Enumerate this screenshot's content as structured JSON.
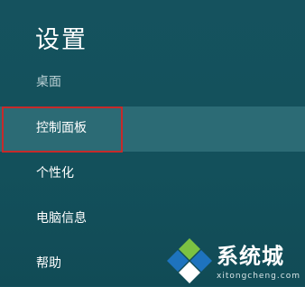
{
  "panel": {
    "title": "设置",
    "context": "桌面"
  },
  "menu": {
    "items": [
      {
        "label": "控制面板",
        "selected": true
      },
      {
        "label": "个性化",
        "selected": false
      },
      {
        "label": "电脑信息",
        "selected": false
      },
      {
        "label": "帮助",
        "selected": false
      }
    ]
  },
  "watermark": {
    "brand": "系统城",
    "url": "xitongcheng.com",
    "colors": {
      "blue": "#1e73be",
      "green": "#7cc242",
      "white": "#ffffff"
    }
  },
  "colors": {
    "background": "#14505c",
    "selected_item": "#2c6b75",
    "highlight_border": "#c62a2a",
    "subtitle": "#b9cfd3"
  }
}
